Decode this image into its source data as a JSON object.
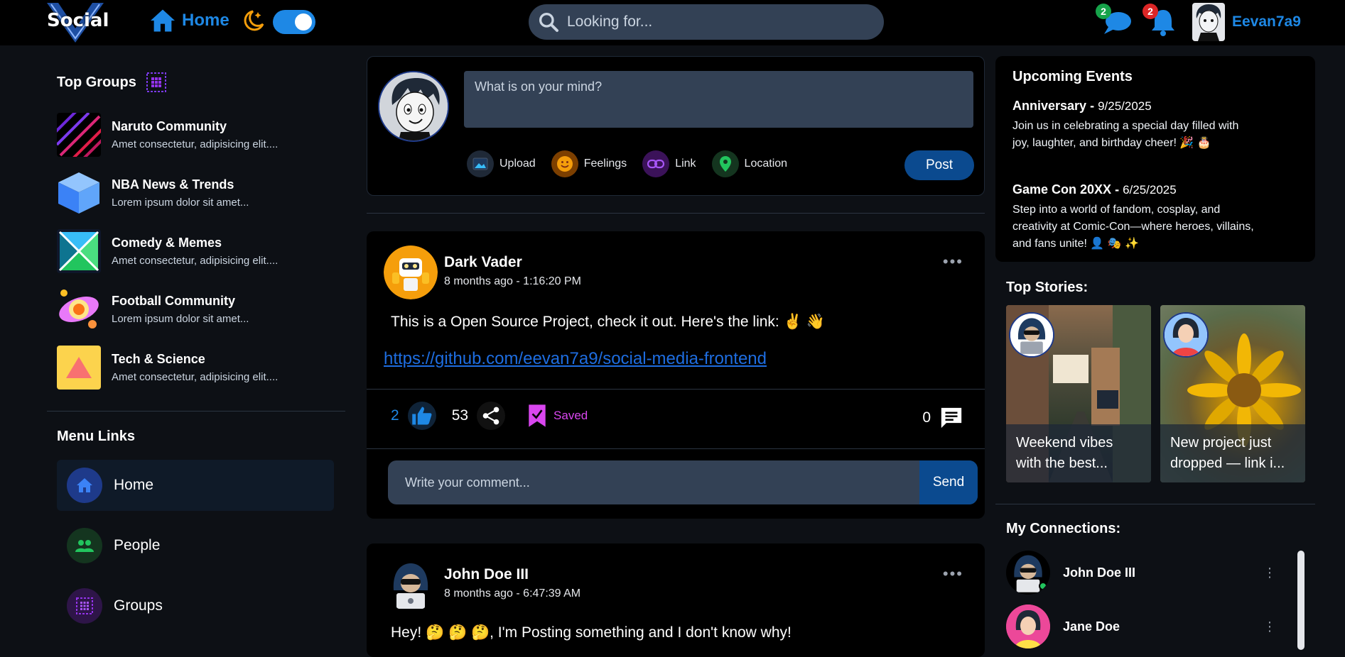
{
  "header": {
    "logo_text": "Social",
    "home_label": "Home",
    "search_placeholder": "Looking for...",
    "messages_count": "2",
    "notifications_count": "2",
    "username": "Eevan7a9",
    "colors": {
      "accent": "#1e88e5",
      "messages_badge": "#16a34a",
      "notifications_badge": "#dc2626"
    }
  },
  "sidebar": {
    "groups_title": "Top Groups",
    "groups": [
      {
        "name": "Naruto Community",
        "desc": "Amet consectetur, adipisicing elit...."
      },
      {
        "name": "NBA News & Trends",
        "desc": "Lorem ipsum dolor sit amet..."
      },
      {
        "name": "Comedy & Memes",
        "desc": "Amet consectetur, adipisicing elit...."
      },
      {
        "name": "Football Community",
        "desc": "Lorem ipsum dolor sit amet..."
      },
      {
        "name": "Tech & Science",
        "desc": "Amet consectetur, adipisicing elit...."
      }
    ],
    "menu_title": "Menu Links",
    "menu": [
      {
        "label": "Home",
        "icon": "home-icon"
      },
      {
        "label": "People",
        "icon": "people-icon"
      },
      {
        "label": "Groups",
        "icon": "groups-icon"
      }
    ]
  },
  "composer": {
    "placeholder": "What is on your mind?",
    "actions": [
      "Upload",
      "Feelings",
      "Link",
      "Location"
    ],
    "post_label": "Post"
  },
  "posts": [
    {
      "author": "Dark Vader",
      "time": "8 months ago - 1:16:20 PM",
      "text": "This is a Open Source Project, check it out. Here's the link: ✌️ 👋",
      "link": "https://github.com/eevan7a9/social-media-frontend",
      "likes": "2",
      "shares": "53",
      "saved_label": "Saved",
      "comments": "0",
      "comment_placeholder": "Write your comment...",
      "send_label": "Send"
    },
    {
      "author": "John Doe III",
      "time": "8 months ago - 6:47:39 AM",
      "text": "Hey! 🤔 🤔 🤔, I'm Posting something and I don't know why!"
    }
  ],
  "events": {
    "title": "Upcoming Events",
    "items": [
      {
        "name": "Anniversary",
        "date": "9/25/2025",
        "desc": "Join us in celebrating a special day filled with joy, laughter, and birthday cheer! 🎉 🎂"
      },
      {
        "name": "Game Con 20XX",
        "date": "6/25/2025",
        "desc": "Step into a world of fandom, cosplay, and creativity at Comic-Con—where heroes, villains, and fans unite! 👤 🎭 ✨"
      }
    ]
  },
  "stories": {
    "title": "Top Stories:",
    "items": [
      {
        "caption": "Weekend vibes with the best..."
      },
      {
        "caption": "New project just dropped — link i..."
      }
    ]
  },
  "connections": {
    "title": "My Connections:",
    "items": [
      {
        "name": "John Doe III",
        "online": true
      },
      {
        "name": "Jane Doe",
        "online": false
      }
    ]
  }
}
